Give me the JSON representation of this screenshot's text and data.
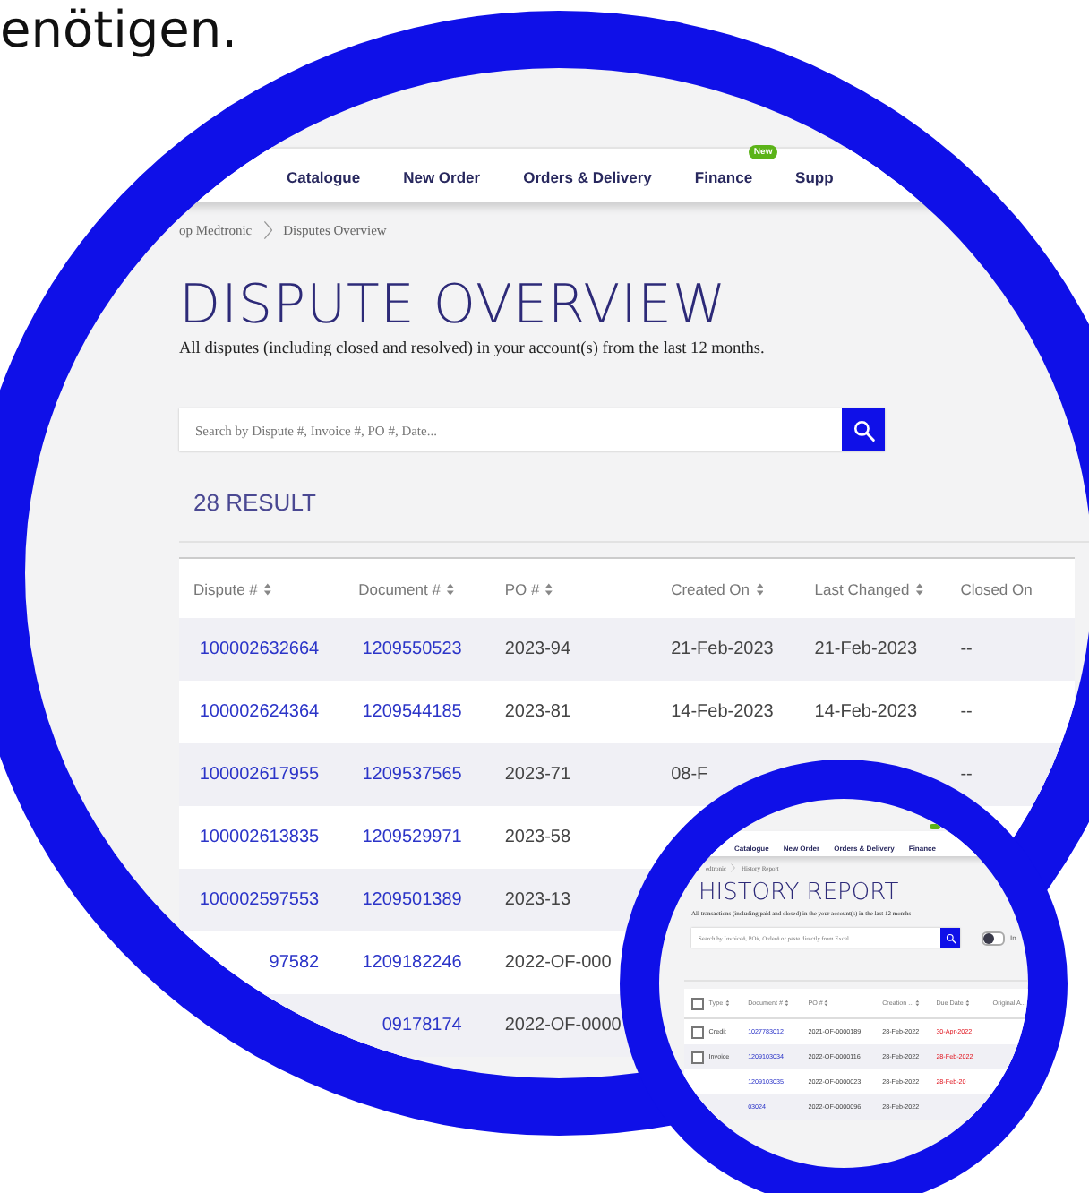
{
  "caption": "enötigen.",
  "dispute_screen": {
    "nav": [
      {
        "label": "Catalogue"
      },
      {
        "label": "New Order"
      },
      {
        "label": "Orders & Delivery"
      },
      {
        "label": "Finance",
        "badge": "New"
      },
      {
        "label": "Supp"
      }
    ],
    "breadcrumb": [
      "op Medtronic",
      "Disputes Overview"
    ],
    "title": "DISPUTE OVERVIEW",
    "subtitle": "All disputes (including closed and resolved) in your account(s) from the last 12 months.",
    "search": {
      "placeholder": "Search by Dispute #, Invoice #, PO #, Date..."
    },
    "result_count": "28 RESULT",
    "table": {
      "columns": [
        "Dispute #",
        "Document #",
        "PO #",
        "Created On",
        "Last Changed",
        "Closed On"
      ],
      "rows": [
        {
          "dispute": "100002632664",
          "document": "1209550523",
          "po": "2023-94",
          "created": "21-Feb-2023",
          "last_changed": "21-Feb-2023",
          "closed": "--"
        },
        {
          "dispute": "100002624364",
          "document": "1209544185",
          "po": "2023-81",
          "created": "14-Feb-2023",
          "last_changed": "14-Feb-2023",
          "closed": "--"
        },
        {
          "dispute": "100002617955",
          "document": "1209537565",
          "po": "2023-71",
          "created": "08-F",
          "closed": "--"
        },
        {
          "dispute": "100002613835",
          "document": "1209529971",
          "po": "2023-58"
        },
        {
          "dispute": "100002597553",
          "document": "1209501389",
          "po": "2023-13"
        },
        {
          "dispute": "97582",
          "document": "1209182246",
          "po": "2022-OF-000"
        },
        {
          "document": "09178174",
          "po": "2022-OF-0000"
        }
      ]
    }
  },
  "history_screen": {
    "nav": [
      {
        "label": "Catalogue"
      },
      {
        "label": "New Order"
      },
      {
        "label": "Orders & Delivery"
      },
      {
        "label": "Finance",
        "new_badge": true
      }
    ],
    "breadcrumb": [
      "edtronic",
      "History Report"
    ],
    "title": "HISTORY REPORT",
    "subtitle": "All transactions (including paid and closed) in the your account(s) in the last 12 months",
    "search": {
      "placeholder": "Search by Invoice#, PO#, Order# or paste directly from Excel..."
    },
    "toggle": {
      "on": false,
      "label": "In"
    },
    "table": {
      "select_all": {
        "checked": false
      },
      "columns": [
        "Type",
        "Document #",
        "PO #",
        "Creation ...",
        "Due Date",
        "Original A..."
      ],
      "rows": [
        {
          "checked": false,
          "type": "Credit",
          "document": "1027783012",
          "po": "2021-OF-0000189",
          "created": "28-Feb-2022",
          "due": "30-Apr-2022",
          "overdue": true
        },
        {
          "checked": false,
          "type": "Invoice",
          "document": "1209103034",
          "po": "2022-OF-0000116",
          "created": "28-Feb-2022",
          "due": "28-Feb-2022",
          "overdue": true
        },
        {
          "document": "1209103035",
          "po": "2022-OF-0000023",
          "created": "28-Feb-2022",
          "due": "28-Feb-20",
          "overdue": true
        },
        {
          "document": "03024",
          "po": "2022-OF-0000096",
          "created": "28-Feb-2022"
        }
      ]
    }
  }
}
